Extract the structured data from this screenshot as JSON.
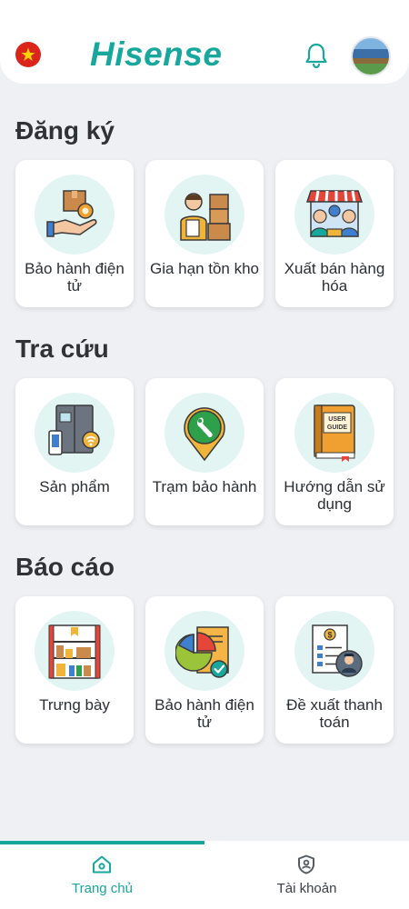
{
  "header": {
    "logo_text": "Hisense",
    "flag_icon": "vietnam-flag-icon",
    "notification_icon": "bell-icon",
    "avatar_icon": "user-avatar"
  },
  "colors": {
    "brand": "#18a79c",
    "background": "#eef0f4",
    "card": "#ffffff",
    "icon_circle": "#e2f5f2"
  },
  "sections": [
    {
      "title": "Đăng ký",
      "items": [
        {
          "label": "Bảo hành điện tử",
          "icon": "warranty-hand-box-icon"
        },
        {
          "label": "Gia hạn tồn kho",
          "icon": "warehouse-worker-icon"
        },
        {
          "label": "Xuất bán hàng hóa",
          "icon": "shop-sales-icon"
        }
      ]
    },
    {
      "title": "Tra cứu",
      "items": [
        {
          "label": "Sản phẩm",
          "icon": "smart-fridge-icon"
        },
        {
          "label": "Trạm bảo hành",
          "icon": "service-location-icon"
        },
        {
          "label": "Hướng dẫn sử dụng",
          "icon": "user-guide-book-icon"
        }
      ]
    },
    {
      "title": "Báo cáo",
      "items": [
        {
          "label": "Trưng bày",
          "icon": "display-shelf-icon"
        },
        {
          "label": "Bảo hành điện tử",
          "icon": "report-chart-icon"
        },
        {
          "label": "Đề xuất thanh toán",
          "icon": "payment-proposal-icon"
        }
      ]
    }
  ],
  "bottom_nav": {
    "tabs": [
      {
        "label": "Trang chủ",
        "icon": "home-icon",
        "active": true
      },
      {
        "label": "Tài khoản",
        "icon": "account-shield-icon",
        "active": false
      }
    ]
  }
}
